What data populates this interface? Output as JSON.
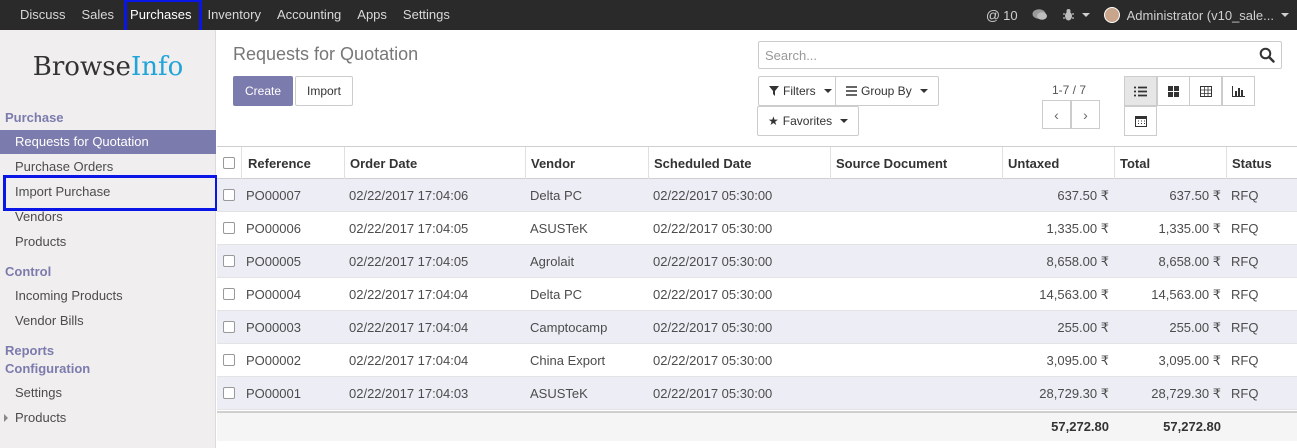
{
  "navbar": {
    "menu": [
      "Discuss",
      "Sales",
      "Purchases",
      "Inventory",
      "Accounting",
      "Apps",
      "Settings"
    ],
    "active": "Purchases",
    "messages_count": "10",
    "user": "Administrator (v10_sale..."
  },
  "sidebar": {
    "logo_main": "Browse",
    "logo_accent": "Info",
    "sections": {
      "purchase": "Purchase",
      "control": "Control",
      "reports": "Reports",
      "configuration": "Configuration"
    },
    "items": {
      "rfq": "Requests for Quotation",
      "purchase_orders": "Purchase Orders",
      "import_purchase": "Import Purchase",
      "vendors": "Vendors",
      "products": "Products",
      "incoming_products": "Incoming Products",
      "vendor_bills": "Vendor Bills",
      "settings": "Settings",
      "config_products": "Products"
    }
  },
  "control_panel": {
    "title": "Requests for Quotation",
    "create_label": "Create",
    "import_label": "Import",
    "search_placeholder": "Search...",
    "filters_label": "Filters",
    "group_by_label": "Group By",
    "favorites_label": "Favorites",
    "pager": "1-7 / 7"
  },
  "table": {
    "headers": {
      "reference": "Reference",
      "order_date": "Order Date",
      "vendor": "Vendor",
      "scheduled_date": "Scheduled Date",
      "source_document": "Source Document",
      "untaxed": "Untaxed",
      "total": "Total",
      "status": "Status"
    },
    "rows": [
      {
        "ref": "PO00007",
        "order_date": "02/22/2017 17:04:06",
        "vendor": "Delta PC",
        "scheduled": "02/22/2017 05:30:00",
        "source": "",
        "untaxed": "637.50 ₹",
        "total": "637.50 ₹",
        "status": "RFQ"
      },
      {
        "ref": "PO00006",
        "order_date": "02/22/2017 17:04:05",
        "vendor": "ASUSTeK",
        "scheduled": "02/22/2017 05:30:00",
        "source": "",
        "untaxed": "1,335.00 ₹",
        "total": "1,335.00 ₹",
        "status": "RFQ"
      },
      {
        "ref": "PO00005",
        "order_date": "02/22/2017 17:04:05",
        "vendor": "Agrolait",
        "scheduled": "02/22/2017 05:30:00",
        "source": "",
        "untaxed": "8,658.00 ₹",
        "total": "8,658.00 ₹",
        "status": "RFQ"
      },
      {
        "ref": "PO00004",
        "order_date": "02/22/2017 17:04:04",
        "vendor": "Delta PC",
        "scheduled": "02/22/2017 05:30:00",
        "source": "",
        "untaxed": "14,563.00 ₹",
        "total": "14,563.00 ₹",
        "status": "RFQ"
      },
      {
        "ref": "PO00003",
        "order_date": "02/22/2017 17:04:04",
        "vendor": "Camptocamp",
        "scheduled": "02/22/2017 05:30:00",
        "source": "",
        "untaxed": "255.00 ₹",
        "total": "255.00 ₹",
        "status": "RFQ"
      },
      {
        "ref": "PO00002",
        "order_date": "02/22/2017 17:04:04",
        "vendor": "China Export",
        "scheduled": "02/22/2017 05:30:00",
        "source": "",
        "untaxed": "3,095.00 ₹",
        "total": "3,095.00 ₹",
        "status": "RFQ"
      },
      {
        "ref": "PO00001",
        "order_date": "02/22/2017 17:04:03",
        "vendor": "ASUSTeK",
        "scheduled": "02/22/2017 05:30:00",
        "source": "",
        "untaxed": "28,729.30 ₹",
        "total": "28,729.30 ₹",
        "status": "RFQ"
      }
    ],
    "footer": {
      "untaxed": "57,272.80",
      "total": "57,272.80"
    }
  },
  "colors": {
    "accent": "#7c7bad",
    "navbar_bg": "#2a2a2a",
    "highlight_box": "#0a16e6",
    "logo_accent": "#21a4d8"
  }
}
